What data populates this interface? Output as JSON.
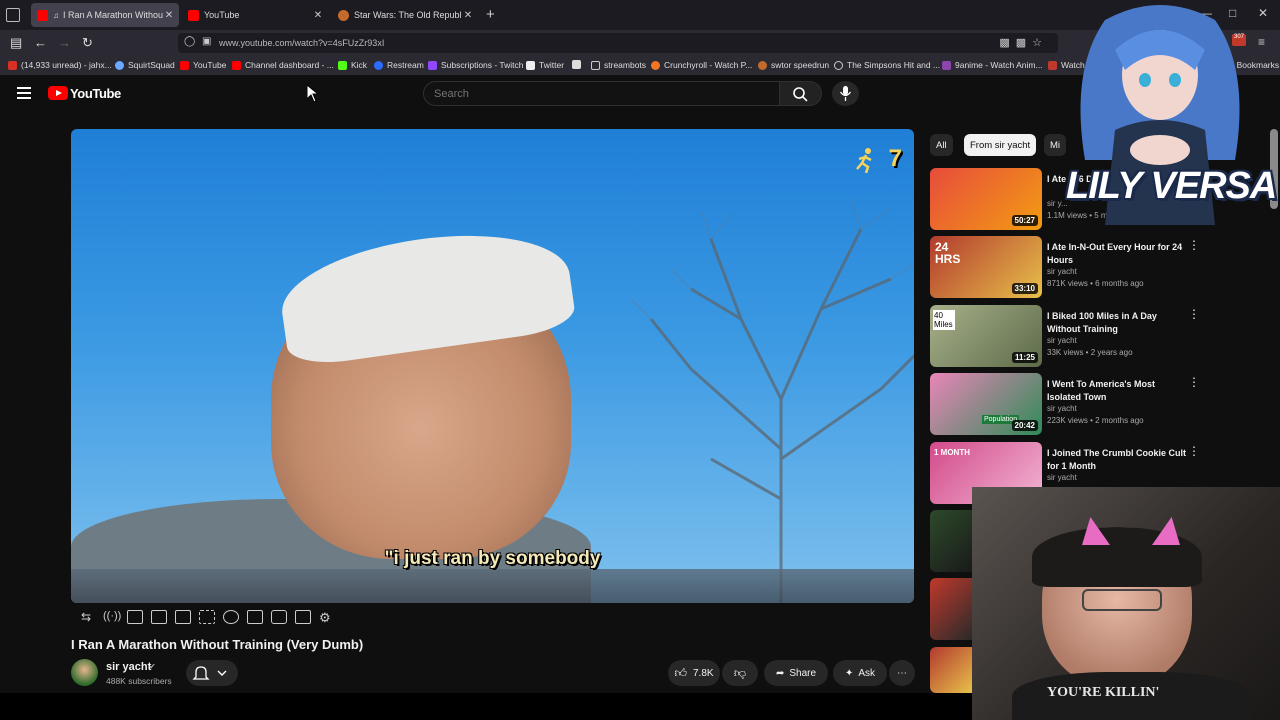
{
  "browser": {
    "tabs": [
      {
        "title": "I Ran A Marathon Without",
        "active": true,
        "audio": true
      },
      {
        "title": "YouTube",
        "active": false
      },
      {
        "title": "Star Wars: The Old Republic - Sp",
        "active": false
      }
    ],
    "url": "www.youtube.com/watch?v=4sFUzZr93xI",
    "bookmarks": [
      "(14,933 unread) - jahx...",
      "SquirtSquad",
      "YouTube",
      "Channel dashboard - ...",
      "Kick",
      "Restream",
      "Subscriptions - Twitch",
      "Twitter",
      "streambots",
      "Crunchyroll - Watch P...",
      "swtor speedrun",
      "The Simpsons Hit and ...",
      "9anime - Watch Anim...",
      "Watch Latest",
      "Other Bookmarks"
    ],
    "extension_badge": "307"
  },
  "youtube": {
    "logo_text": "YouTube",
    "search_placeholder": "Search"
  },
  "video": {
    "subtitle": "\"i just ran by somebody",
    "counter": "7",
    "title": "I Ran A Marathon Without Training (Very Dumb)",
    "channel": "sir yacht",
    "subscribers": "488K subscribers",
    "likes": "7.8K",
    "share_label": "Share",
    "ask_label": "Ask"
  },
  "filter_chips": [
    "All",
    "From sir yacht",
    "Mi"
  ],
  "recommendations": [
    {
      "title": "I Ate ... 6 Da...",
      "channel": "sir y...",
      "meta": "1.1M views • 5 months ago",
      "duration": "50:27",
      "color": "#c0392b"
    },
    {
      "title": "I Ate In-N-Out Every Hour for 24 Hours",
      "channel": "sir yacht",
      "meta": "871K views • 6 months ago",
      "duration": "33:10",
      "color": "#b23a2e",
      "badge": "24 HRS"
    },
    {
      "title": "I Biked 100 Miles in A Day Without Training",
      "channel": "sir yacht",
      "meta": "33K views • 2 years ago",
      "duration": "11:25",
      "color": "#7a8a6a",
      "badge": "40 Miles"
    },
    {
      "title": "I Went To America's Most Isolated Town",
      "channel": "sir yacht",
      "meta": "223K views • 2 months ago",
      "duration": "20:42",
      "color": "#2e8b57",
      "badge": "Population"
    },
    {
      "title": "I Joined The Crumbl Cookie Cult for 1 Month",
      "channel": "sir yacht",
      "meta": "",
      "duration": "",
      "color": "#d24a8a",
      "badge": "1 MONTH"
    }
  ],
  "overlay": {
    "vtuber_name": "LILY VERSA",
    "shirt_text": "YOU'RE KILLIN'"
  }
}
